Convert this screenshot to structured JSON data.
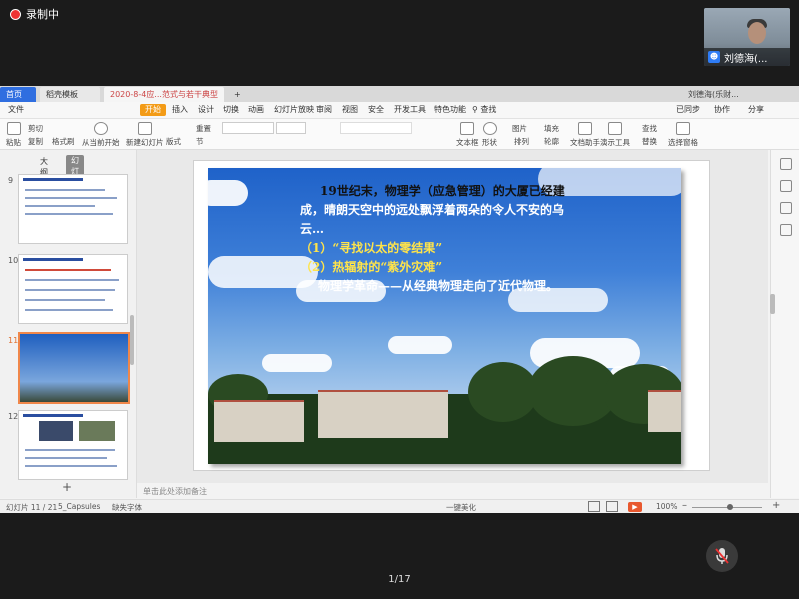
{
  "meeting": {
    "recording_label": "录制中",
    "participant_name": "刘德海(...",
    "page_indicator": "1/17"
  },
  "tabs": {
    "home": "首页",
    "templates": "稻壳模板",
    "document": "2020-8-4应...范式与若干典型问题",
    "add": "+",
    "right_user": "刘德海(乐财..."
  },
  "menu": {
    "file": "文件",
    "items": [
      "开始",
      "插入",
      "设计",
      "切换",
      "动画",
      "幻灯片放映",
      "审阅",
      "视图",
      "安全",
      "开发工具",
      "特色功能"
    ],
    "search": "查找",
    "sync": "已同步",
    "collab": "协作",
    "share": "分享"
  },
  "ribbon": {
    "cut": "剪切",
    "copy": "复制",
    "format_painter": "格式刷",
    "paste": "粘贴",
    "from_current": "从当前开始",
    "new_slide": "新建幻灯片",
    "layout": "版式",
    "section": "节",
    "reset": "重置",
    "textbox": "文本框",
    "shape": "形状",
    "arrange": "排列",
    "picture": "图片",
    "fill": "填充",
    "outline": "轮廓",
    "doc_assistant": "文档助手",
    "presentation_tools": "演示工具",
    "find": "查找",
    "replace": "替换",
    "select_pane": "选择窗格"
  },
  "left_pane": {
    "outline_tab": "大纲",
    "slides_tab": "幻灯片",
    "thumb_numbers": [
      "9",
      "10",
      "11",
      "12"
    ],
    "add_slide": "+"
  },
  "slide": {
    "line1": "19世纪末，物理学（应急管理）的大厦已经建",
    "line2": "成，晴朗天空中的远处飘浮着两朵的令人不安的乌",
    "line3": "云…",
    "item1": "（1）“寻找以太的零结果”",
    "item2": "（2）热辐射的“紫外灾难”",
    "conclusion": "物理学革命——从经典物理走向了近代物理。",
    "colors": {
      "body_text": "#ffffff",
      "highlight": "#ffe44a"
    }
  },
  "notes_placeholder": "单击此处添加备注",
  "status": {
    "slide_counter": "幻灯片 11 / 21",
    "theme": "5_Capsules",
    "missing_font": "缺失字体",
    "beautify": "一键美化",
    "zoom": "100%",
    "zoom_level_percent": 100
  },
  "icons": [
    "record-dot-icon",
    "user-icon",
    "mic-off-icon",
    "search-icon",
    "play-icon",
    "plus-icon"
  ]
}
